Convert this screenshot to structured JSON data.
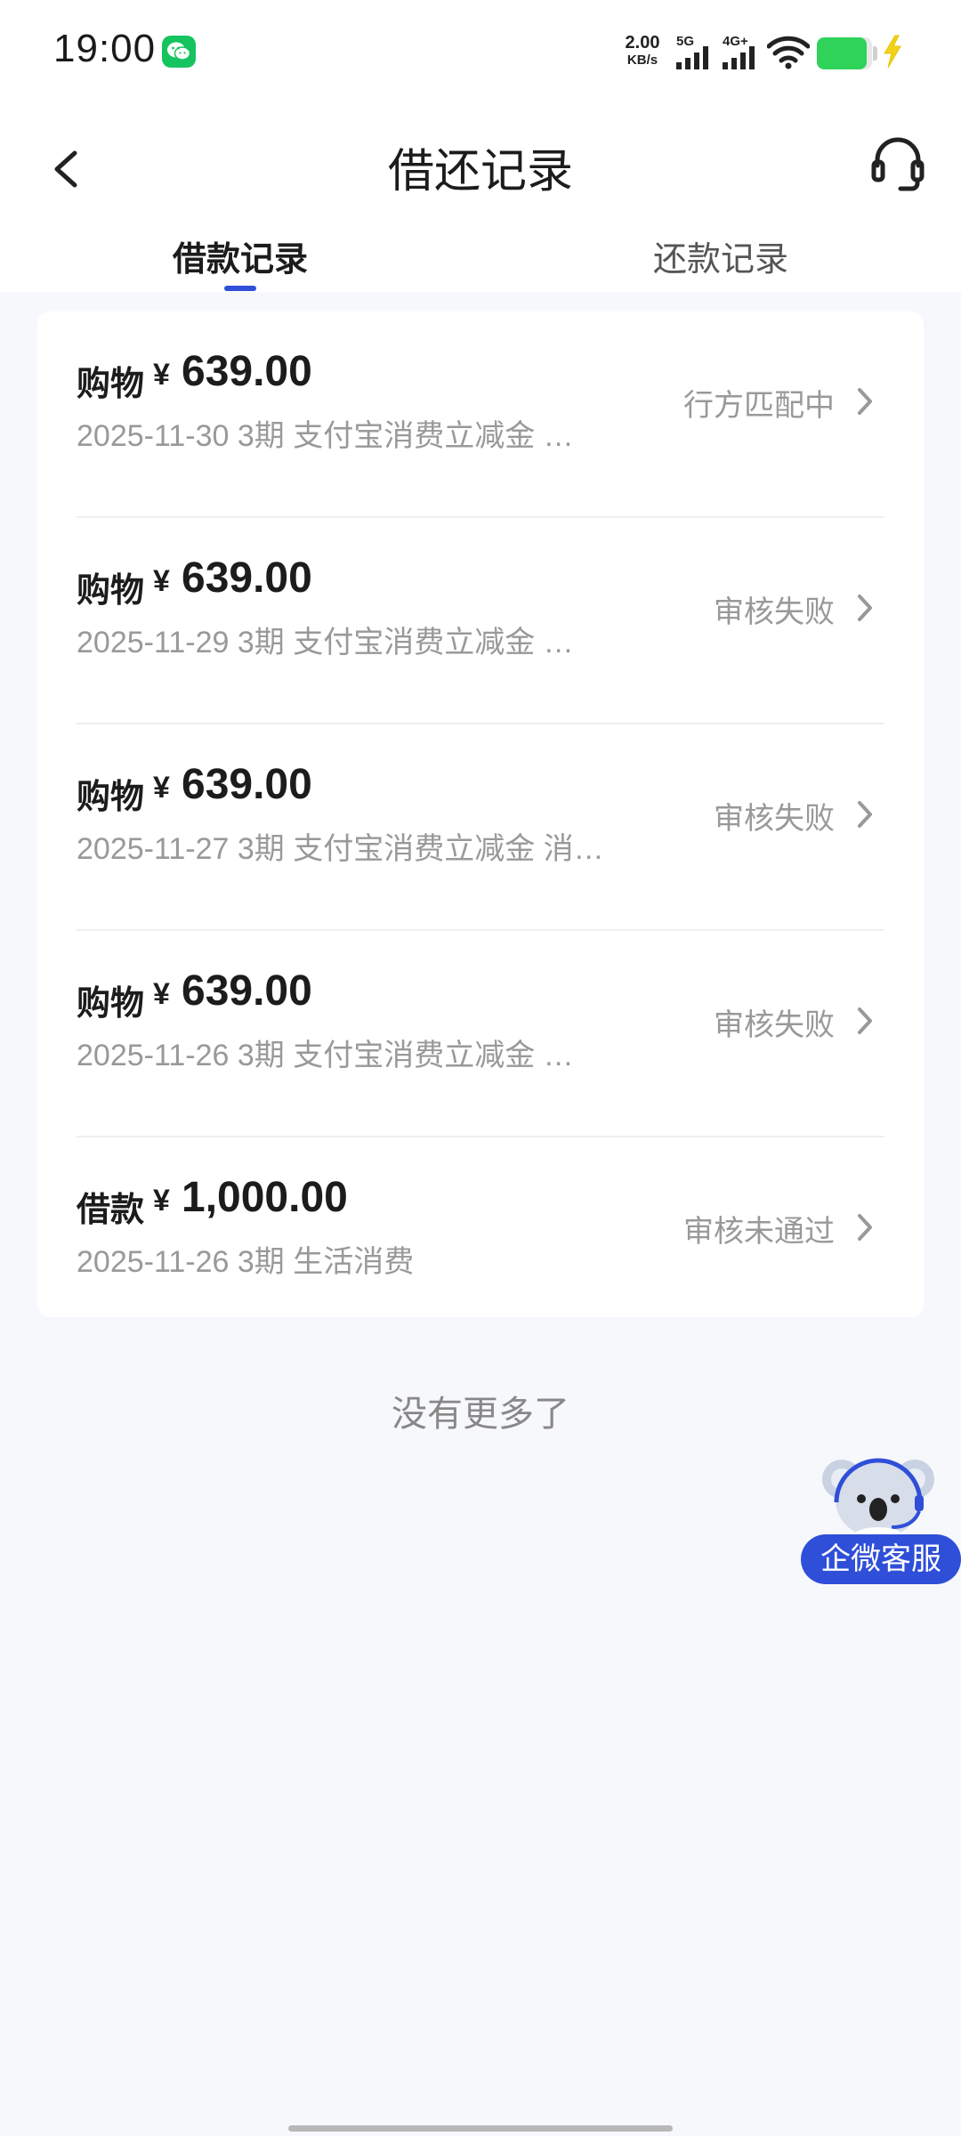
{
  "status_bar": {
    "time": "19:00",
    "net_speed_value": "2.00",
    "net_speed_unit": "KB/s",
    "signal_1_label": "5G",
    "signal_2_label": "4G+",
    "battery_fraction": 0.9
  },
  "header": {
    "title": "借还记录"
  },
  "tabs": [
    {
      "label": "借款记录",
      "active": true
    },
    {
      "label": "还款记录",
      "active": false
    }
  ],
  "records": [
    {
      "type": "购物",
      "currency": "¥",
      "amount": "639.00",
      "detail": "2025-11-30 3期  支付宝消费立减金 …",
      "status": "行方匹配中"
    },
    {
      "type": "购物",
      "currency": "¥",
      "amount": "639.00",
      "detail": "2025-11-29 3期  支付宝消费立减金 …",
      "status": "审核失败"
    },
    {
      "type": "购物",
      "currency": "¥",
      "amount": "639.00",
      "detail": "2025-11-27 3期  支付宝消费立减金 消…",
      "status": "审核失败"
    },
    {
      "type": "购物",
      "currency": "¥",
      "amount": "639.00",
      "detail": "2025-11-26 3期  支付宝消费立减金 …",
      "status": "审核失败"
    },
    {
      "type": "借款",
      "currency": "¥",
      "amount": "1,000.00",
      "detail": "2025-11-26 3期  生活消费",
      "status": "审核未通过"
    }
  ],
  "footer_text": "没有更多了",
  "service_widget": {
    "label": "企微客服"
  },
  "colors": {
    "accent": "#2f4fd8",
    "background": "#f7f8fc",
    "battery": "#2fd35a",
    "wechat": "#16c45f"
  }
}
